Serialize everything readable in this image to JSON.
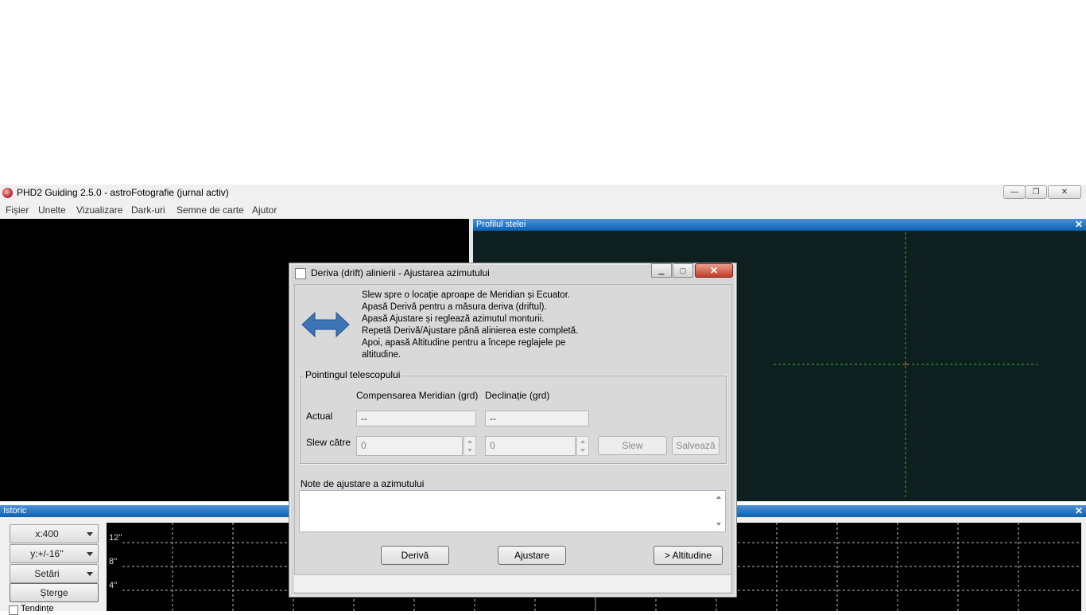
{
  "window": {
    "title": "PHD2 Guiding 2.5.0 - astroFotografie (jurnal activ)",
    "controls": [
      "—",
      "❐",
      "✕"
    ]
  },
  "menu": [
    "Fișier",
    "Unelte",
    "Vizualizare",
    "Dark-uri",
    "Semne de carte",
    "Ajutor"
  ],
  "profile_pane": {
    "title": "Profilul stelei",
    "close": "✕"
  },
  "history_pane": {
    "title": "Istoric",
    "close": "✕",
    "x_scale": "x:400",
    "y_scale": "y:+/-16''",
    "settings": "Setări",
    "clear": "Șterge",
    "trends": "Tendințe",
    "y_labels": [
      "12''",
      "8''",
      "4''"
    ]
  },
  "dialog": {
    "title": "Deriva (drift) alinierii - Ajustarea azimutului",
    "instructions": [
      "Slew spre o locație aproape de Meridian și Ecuator.",
      "Apasă Derivă pentru a măsura deriva (driftul).",
      "Apasă Ajustare  și reglează azimutul monturii.",
      "Repetă Derivă/Ajustare până alinierea este completă.",
      "Apoi, apasă Altitudine pentru a începe reglajele pe",
      "altitudine."
    ],
    "group_label": "Pointingul telescopului",
    "col_meridian": "Compensarea Meridian (grd)",
    "col_dec": "Declinație (grd)",
    "row_current": "Actual",
    "row_slew": "Slew către",
    "current_meridian": "--",
    "current_dec": "--",
    "slew_meridian": "0",
    "slew_dec": "0",
    "slew_button": "Slew",
    "save_button": "Salvează",
    "notes_label": "Note de ajustare a azimutului",
    "notes_value": "",
    "drift_button": "Derivă",
    "adjust_button": "Ajustare",
    "altitude_button": "> Altitudine"
  },
  "colors": {
    "pane_header": "#0b62b3",
    "profile_bg": "#0e1f1f",
    "crosshair": "#2fb82f",
    "arrow": "#3d74b8"
  }
}
